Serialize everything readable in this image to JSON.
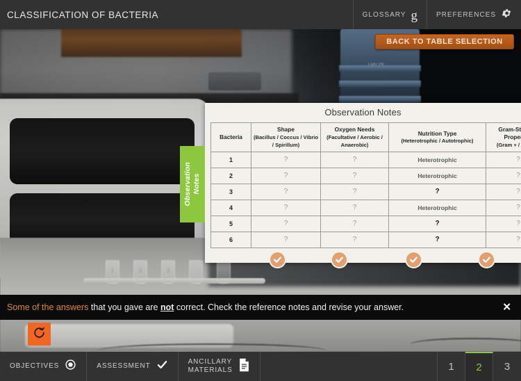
{
  "header": {
    "app_title": "CLASSIFICATION OF BACTERIA",
    "glossary_label": "GLOSSARY",
    "glossary_icon": "glossary-g-icon",
    "preferences_label": "PREFERENCES",
    "preferences_icon": "gear-icon"
  },
  "back_button": {
    "label": "BACK TO TABLE SELECTION"
  },
  "side_tab": {
    "line1": "Observation",
    "line2": "Notes",
    "color": "#8dc63f"
  },
  "panel": {
    "title": "Observation Notes",
    "columns": [
      {
        "title": "Bacteria",
        "sub": ""
      },
      {
        "title": "Shape",
        "sub": "(Bacillus / Coccus / Vibrio / Spirillum)"
      },
      {
        "title": "Oxygen Needs",
        "sub": "(Facultative / Aerobic / Anaerobic)"
      },
      {
        "title": "Nutrition Type",
        "sub": "(Heterotrophic / Autotrophic)"
      },
      {
        "title": "Gram-Staining Properties",
        "sub": "(Gram + / Gram -)"
      }
    ],
    "rows": [
      {
        "bacteria": "1",
        "shape": "?",
        "oxygen": "?",
        "nutrition": "Heterotrophic",
        "gram": "?",
        "nutrition_wrong": false
      },
      {
        "bacteria": "2",
        "shape": "?",
        "oxygen": "?",
        "nutrition": "Heterotrophic",
        "gram": "?",
        "nutrition_wrong": false
      },
      {
        "bacteria": "3",
        "shape": "?",
        "oxygen": "?",
        "nutrition": "?",
        "gram": "?",
        "nutrition_wrong": true
      },
      {
        "bacteria": "4",
        "shape": "?",
        "oxygen": "?",
        "nutrition": "Heterotrophic",
        "gram": "?",
        "nutrition_wrong": false
      },
      {
        "bacteria": "5",
        "shape": "?",
        "oxygen": "?",
        "nutrition": "?",
        "gram": "?",
        "nutrition_wrong": true
      },
      {
        "bacteria": "6",
        "shape": "?",
        "oxygen": "?",
        "nutrition": "?",
        "gram": "?",
        "nutrition_wrong": true
      }
    ],
    "check_buttons": [
      {
        "column": "shape",
        "icon": "check-icon"
      },
      {
        "column": "oxygen",
        "icon": "check-icon"
      },
      {
        "column": "nutrition",
        "icon": "check-icon"
      },
      {
        "column": "gram",
        "icon": "check-icon"
      }
    ],
    "check_color": "#e2a070"
  },
  "notification": {
    "highlight": "Some of the answers",
    "text_before_not": " that you gave are ",
    "emphasis": "not",
    "text_after_not": " correct. Check the reference notes and revise your answer.",
    "close_icon": "close-icon",
    "highlight_color": "#e08a2e"
  },
  "reset_button": {
    "icon": "reset-icon",
    "color": "#f26522"
  },
  "footer": {
    "items": [
      {
        "label": "OBJECTIVES",
        "icon": "target-icon"
      },
      {
        "label_line1": "ASSESSMENT",
        "label_line2": "",
        "icon": "check-icon"
      },
      {
        "label_line1": "ANCILLARY",
        "label_line2": "MATERIALS",
        "icon": "document-icon"
      }
    ],
    "pages": [
      {
        "number": "1",
        "active": false
      },
      {
        "number": "2",
        "active": true
      },
      {
        "number": "3",
        "active": false
      }
    ],
    "active_color": "#8dc63f"
  },
  "background": {
    "light_on_label": "Light ON",
    "tube_labels": [
      "1",
      "2",
      "3"
    ]
  }
}
